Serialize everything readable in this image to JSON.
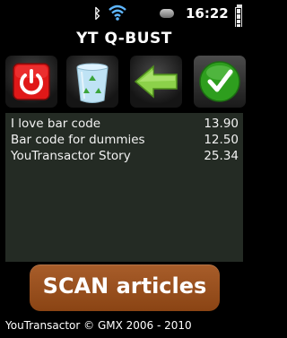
{
  "status": {
    "time": "16:22",
    "icons": [
      "bluetooth-icon",
      "wifi-icon",
      "status-pill-icon",
      "battery-icon"
    ]
  },
  "app": {
    "title": "YT Q-BUST"
  },
  "toolbar": {
    "buttons": [
      {
        "icon": "power-icon",
        "color": "#e01818"
      },
      {
        "icon": "recycle-bin-icon",
        "color": "#bfe3f5"
      },
      {
        "icon": "back-arrow-icon",
        "color": "#8cd14a"
      },
      {
        "icon": "checkmark-icon",
        "color": "#2e9e1e"
      }
    ]
  },
  "items": [
    {
      "name": "I love bar code",
      "price": "13.90"
    },
    {
      "name": "Bar code for dummies",
      "price": "12.50"
    },
    {
      "name": "YouTransactor Story",
      "price": "25.34"
    }
  ],
  "scan": {
    "label": "SCAN articles",
    "color": "#9a4f1e"
  },
  "footer": {
    "text": "YouTransactor © GMX 2006 - 2010"
  }
}
